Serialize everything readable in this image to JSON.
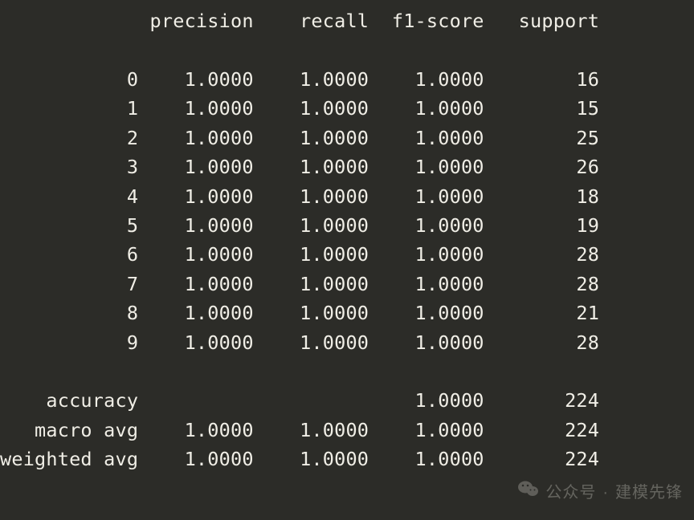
{
  "headers": {
    "precision": "precision",
    "recall": "recall",
    "f1": "f1-score",
    "support": "support"
  },
  "classes": [
    {
      "label": "0",
      "precision": "1.0000",
      "recall": "1.0000",
      "f1": "1.0000",
      "support": "16"
    },
    {
      "label": "1",
      "precision": "1.0000",
      "recall": "1.0000",
      "f1": "1.0000",
      "support": "15"
    },
    {
      "label": "2",
      "precision": "1.0000",
      "recall": "1.0000",
      "f1": "1.0000",
      "support": "25"
    },
    {
      "label": "3",
      "precision": "1.0000",
      "recall": "1.0000",
      "f1": "1.0000",
      "support": "26"
    },
    {
      "label": "4",
      "precision": "1.0000",
      "recall": "1.0000",
      "f1": "1.0000",
      "support": "18"
    },
    {
      "label": "5",
      "precision": "1.0000",
      "recall": "1.0000",
      "f1": "1.0000",
      "support": "19"
    },
    {
      "label": "6",
      "precision": "1.0000",
      "recall": "1.0000",
      "f1": "1.0000",
      "support": "28"
    },
    {
      "label": "7",
      "precision": "1.0000",
      "recall": "1.0000",
      "f1": "1.0000",
      "support": "28"
    },
    {
      "label": "8",
      "precision": "1.0000",
      "recall": "1.0000",
      "f1": "1.0000",
      "support": "21"
    },
    {
      "label": "9",
      "precision": "1.0000",
      "recall": "1.0000",
      "f1": "1.0000",
      "support": "28"
    }
  ],
  "summary": {
    "accuracy": {
      "label": "accuracy",
      "precision": "",
      "recall": "",
      "f1": "1.0000",
      "support": "224"
    },
    "macro_avg": {
      "label": "macro avg",
      "precision": "1.0000",
      "recall": "1.0000",
      "f1": "1.0000",
      "support": "224"
    },
    "weighted_avg": {
      "label": "weighted avg",
      "precision": "1.0000",
      "recall": "1.0000",
      "f1": "1.0000",
      "support": "224"
    }
  },
  "watermark": {
    "prefix": "公众号",
    "sep": "·",
    "name": "建模先锋"
  },
  "col_widths": {
    "label": 12,
    "metric": 10,
    "support": 10
  }
}
